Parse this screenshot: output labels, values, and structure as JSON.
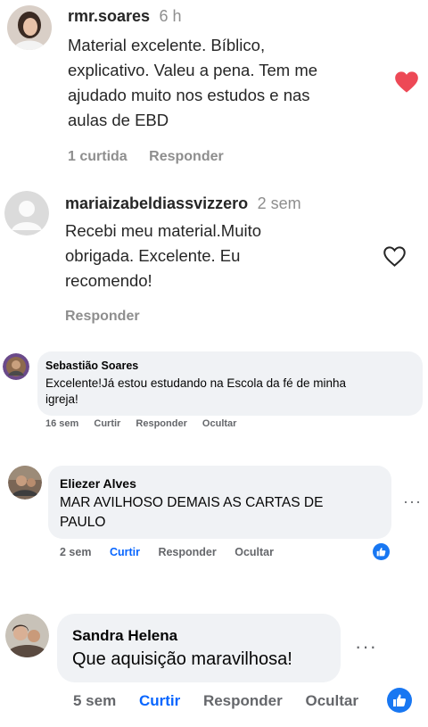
{
  "comments_ig": [
    {
      "user": "rmr.soares",
      "time": "6 h",
      "text_lines": [
        "Material excelente. Bíblico,",
        "explicativo. Valeu a pena. Tem me",
        "ajudado muito nos estudos e nas",
        "aulas de EBD"
      ],
      "likes": "1 curtida",
      "reply": "Responder",
      "heart_icon": "heart-filled",
      "heart_color": "#ed4956"
    },
    {
      "user": "mariaizabeldiassvizzero",
      "time": "2 sem",
      "text_lines": [
        "Recebi meu material.Muito",
        "obrigada. Excelente. Eu",
        "recomendo!"
      ],
      "reply": "Responder",
      "heart_icon": "heart-outline"
    }
  ],
  "comments_fb": [
    {
      "name": "Sebastião Soares",
      "text_lines": [
        "Excelente!Já estou estudando na Escola da fé de minha",
        "igreja!"
      ],
      "time": "16 sem",
      "like": "Curtir",
      "reply": "Responder",
      "hide": "Ocultar"
    },
    {
      "name": "Eliezer Alves",
      "text_lines": [
        "MAR AVILHOSO DEMAIS AS CARTAS DE",
        "PAULO"
      ],
      "time": "2 sem",
      "like": "Curtir",
      "reply": "Responder",
      "hide": "Ocultar",
      "more": "···"
    },
    {
      "name": "Sandra Helena",
      "text": "Que aquisição maravilhosa!",
      "time": "5 sem",
      "like": "Curtir",
      "reply": "Responder",
      "hide": "Ocultar",
      "more": "···"
    }
  ],
  "colors": {
    "facebook_blue": "#1877f2",
    "like_text_blue": "#0866ff",
    "bubble": "#f0f2f5"
  }
}
